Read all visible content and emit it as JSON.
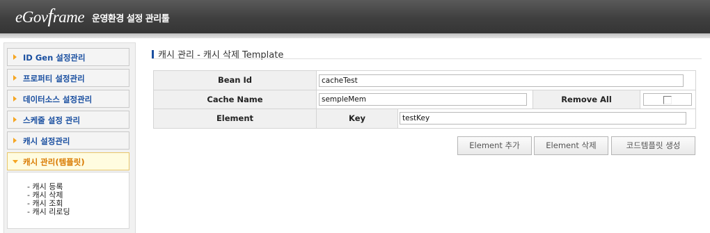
{
  "header": {
    "logo_prefix": "eGov",
    "logo_f": "f",
    "logo_suffix": "rame",
    "title": "운영환경 설정 관리툴"
  },
  "sidebar": {
    "items": [
      {
        "label": "ID Gen 설정관리"
      },
      {
        "label": "프로퍼티 설정관리"
      },
      {
        "label": "데이터소스 설정관리"
      },
      {
        "label": "스케줄 설정 관리"
      },
      {
        "label": "캐시 설정관리"
      },
      {
        "label": "캐시 관리(템플릿)"
      }
    ],
    "subitems": [
      {
        "label": "- 캐시 등록"
      },
      {
        "label": "- 캐시 삭제"
      },
      {
        "label": "- 캐시 조회"
      },
      {
        "label": "- 캐시 리로딩"
      }
    ]
  },
  "main": {
    "title": "캐시 관리 - 캐시 삭제 Template",
    "form": {
      "bean_id_label": "Bean Id",
      "bean_id_value": "cacheTest",
      "cache_name_label": "Cache Name",
      "cache_name_value": "sempleMem",
      "remove_all_label": "Remove All",
      "element_label": "Element",
      "key_label": "Key",
      "key_value": "testKey"
    },
    "buttons": {
      "add": "Element 추가",
      "delete": "Element 삭제",
      "generate": "코드템플릿 생성"
    }
  },
  "colors": {
    "header": "#3f3f3f",
    "menu_label": "#1a4fa0",
    "active_menu_label": "#d97a00",
    "arrow": "#f5a623"
  }
}
